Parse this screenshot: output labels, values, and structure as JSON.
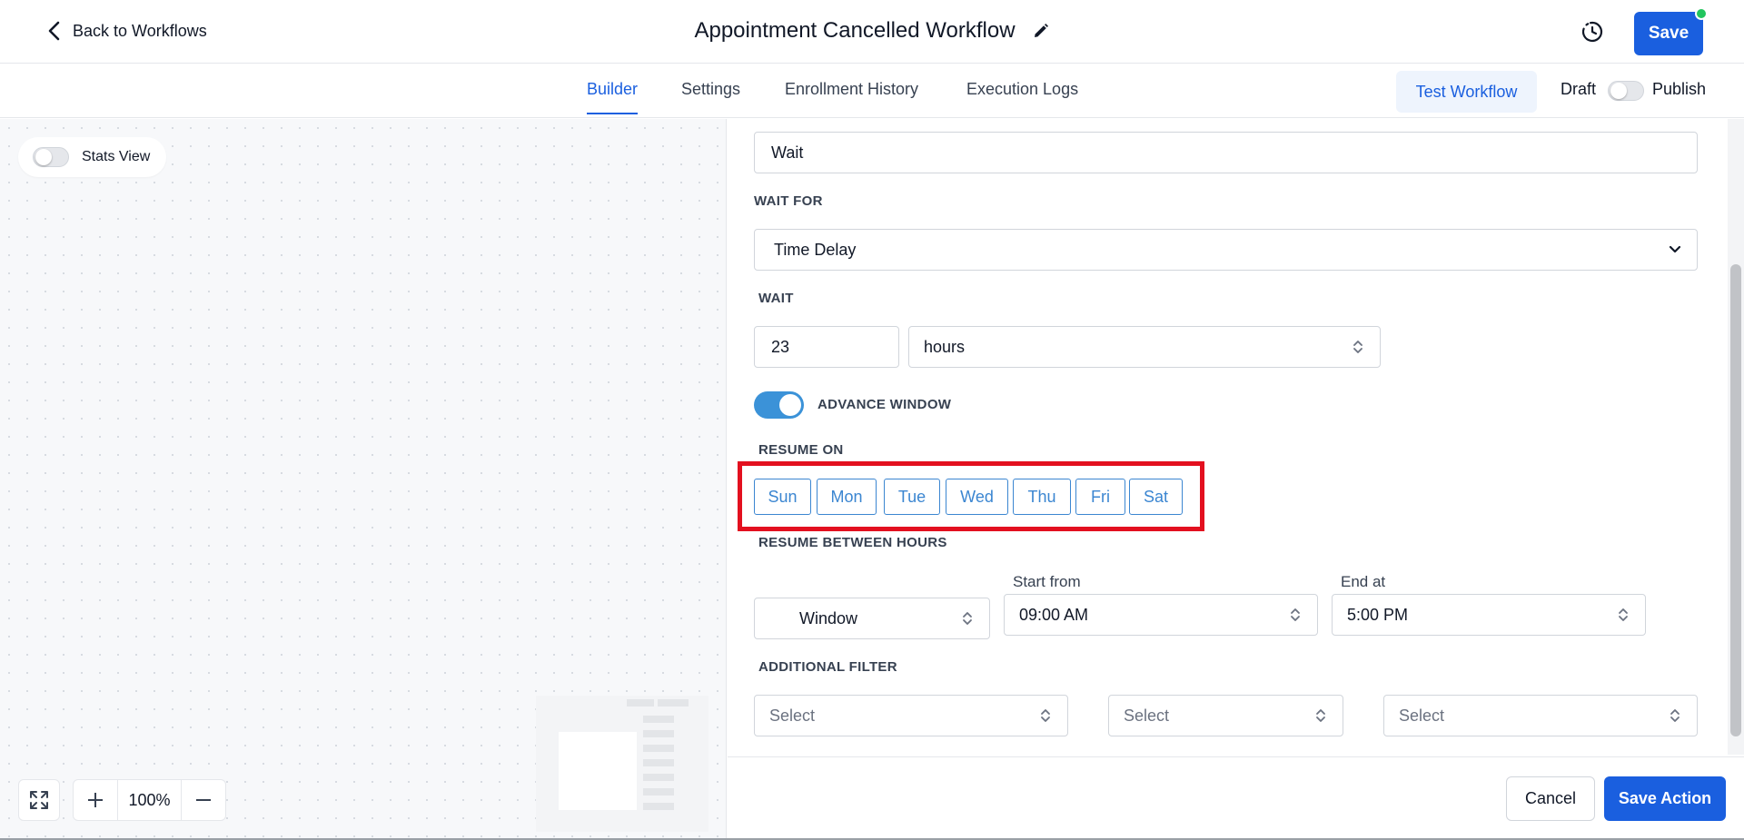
{
  "header": {
    "back_label": "Back to Workflows",
    "title": "Appointment Cancelled Workflow",
    "save_label": "Save"
  },
  "tabs": [
    {
      "label": "Builder",
      "active": true
    },
    {
      "label": "Settings",
      "active": false
    },
    {
      "label": "Enrollment History",
      "active": false
    },
    {
      "label": "Execution Logs",
      "active": false
    }
  ],
  "toolbar": {
    "test_label": "Test Workflow",
    "draft_label": "Draft",
    "publish_label": "Publish",
    "published": false
  },
  "canvas": {
    "stats_label": "Stats View",
    "stats_enabled": false,
    "zoom": "100%"
  },
  "form": {
    "action_name": "Wait",
    "wait_for_label": "WAIT FOR",
    "wait_for_value": "Time Delay",
    "wait_label": "WAIT",
    "wait_amount": "23",
    "wait_unit": "hours",
    "advance_window_label": "ADVANCE WINDOW",
    "advance_window_enabled": true,
    "resume_on_label": "RESUME ON",
    "days": [
      "Sun",
      "Mon",
      "Tue",
      "Wed",
      "Thu",
      "Fri",
      "Sat"
    ],
    "resume_between_label": "RESUME BETWEEN HOURS",
    "window_type": "Window",
    "start_from_label": "Start from",
    "start_from_value": "09:00 AM",
    "end_at_label": "End at",
    "end_at_value": "5:00 PM",
    "additional_filter_label": "ADDITIONAL FILTER",
    "filter_placeholders": [
      "Select",
      "Select",
      "Select"
    ]
  },
  "footer": {
    "cancel_label": "Cancel",
    "save_action_label": "Save Action"
  },
  "colors": {
    "primary": "#1a5fdf",
    "day_outline": "#3b86d1",
    "toggle_on": "#3b92d8",
    "highlight_frame": "#e3101f",
    "status_dot": "#22c55e"
  }
}
